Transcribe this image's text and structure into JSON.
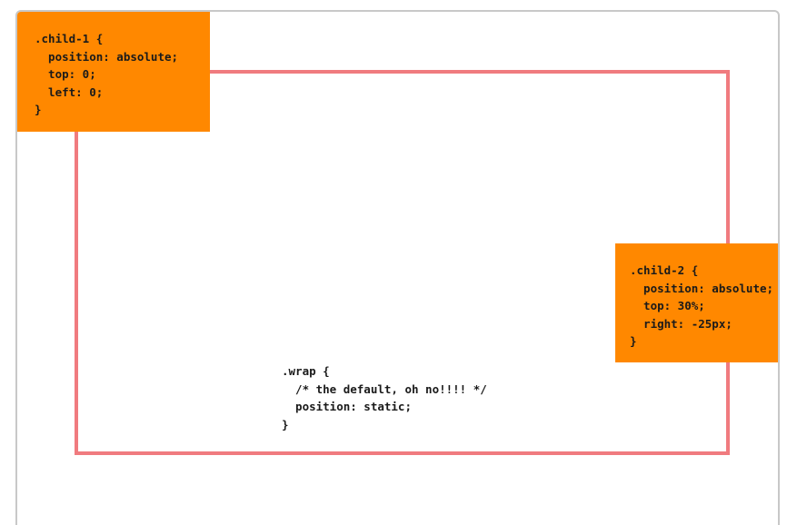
{
  "wrap": {
    "code": ".wrap {\n  /* the default, oh no!!!! */\n  position: static;\n}",
    "border_color": "#f07b7f"
  },
  "child1": {
    "code": ".child-1 {\n  position: absolute;\n  top: 0;\n  left: 0;\n}",
    "background": "#ff8800"
  },
  "child2": {
    "code": ".child-2 {\n  position: absolute;\n  top: 30%;\n  right: -25px;\n}",
    "background": "#ff8800"
  }
}
